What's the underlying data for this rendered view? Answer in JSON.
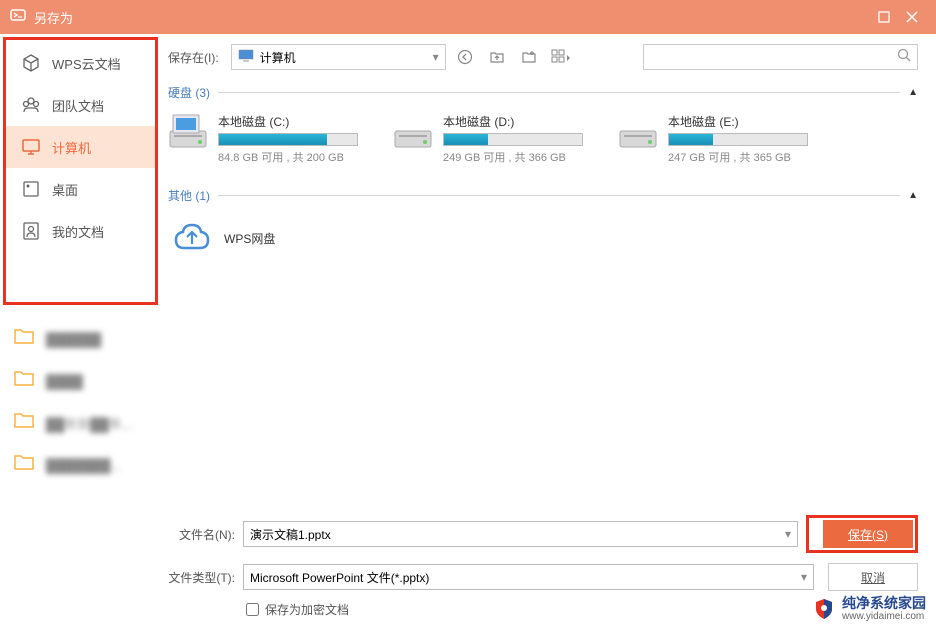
{
  "titlebar": {
    "title": "另存为"
  },
  "sidebar": {
    "items": [
      {
        "label": "WPS云文档"
      },
      {
        "label": "团队文档"
      },
      {
        "label": "计算机"
      },
      {
        "label": "桌面"
      },
      {
        "label": "我的文档"
      }
    ]
  },
  "folders": [
    {
      "label": "██████"
    },
    {
      "label": "████"
    },
    {
      "label": "██年到██年..."
    },
    {
      "label": "███████..."
    }
  ],
  "toolbar": {
    "location_label": "保存在(I):",
    "location_value": "计算机"
  },
  "sections": {
    "drives_label": "硬盘 (3)",
    "others_label": "其他 (1)"
  },
  "drives": [
    {
      "name": "本地磁盘 (C:)",
      "fill_pct": 78,
      "size": "84.8 GB 可用 , 共 200 GB"
    },
    {
      "name": "本地磁盘 (D:)",
      "fill_pct": 32,
      "size": "249 GB 可用 , 共 366 GB"
    },
    {
      "name": "本地磁盘 (E:)",
      "fill_pct": 32,
      "size": "247 GB 可用 , 共 365 GB"
    }
  ],
  "others": {
    "wps_cloud": "WPS网盘"
  },
  "form": {
    "filename_label": "文件名(N):",
    "filename_value": "演示文稿1.pptx",
    "filetype_label": "文件类型(T):",
    "filetype_value": "Microsoft PowerPoint 文件(*.pptx)",
    "save_label": "保存(S)",
    "cancel_label": "取消",
    "encrypt_label": "保存为加密文档"
  },
  "watermark": {
    "main": "纯净系统家园",
    "sub": "www.yidaimei.com"
  }
}
